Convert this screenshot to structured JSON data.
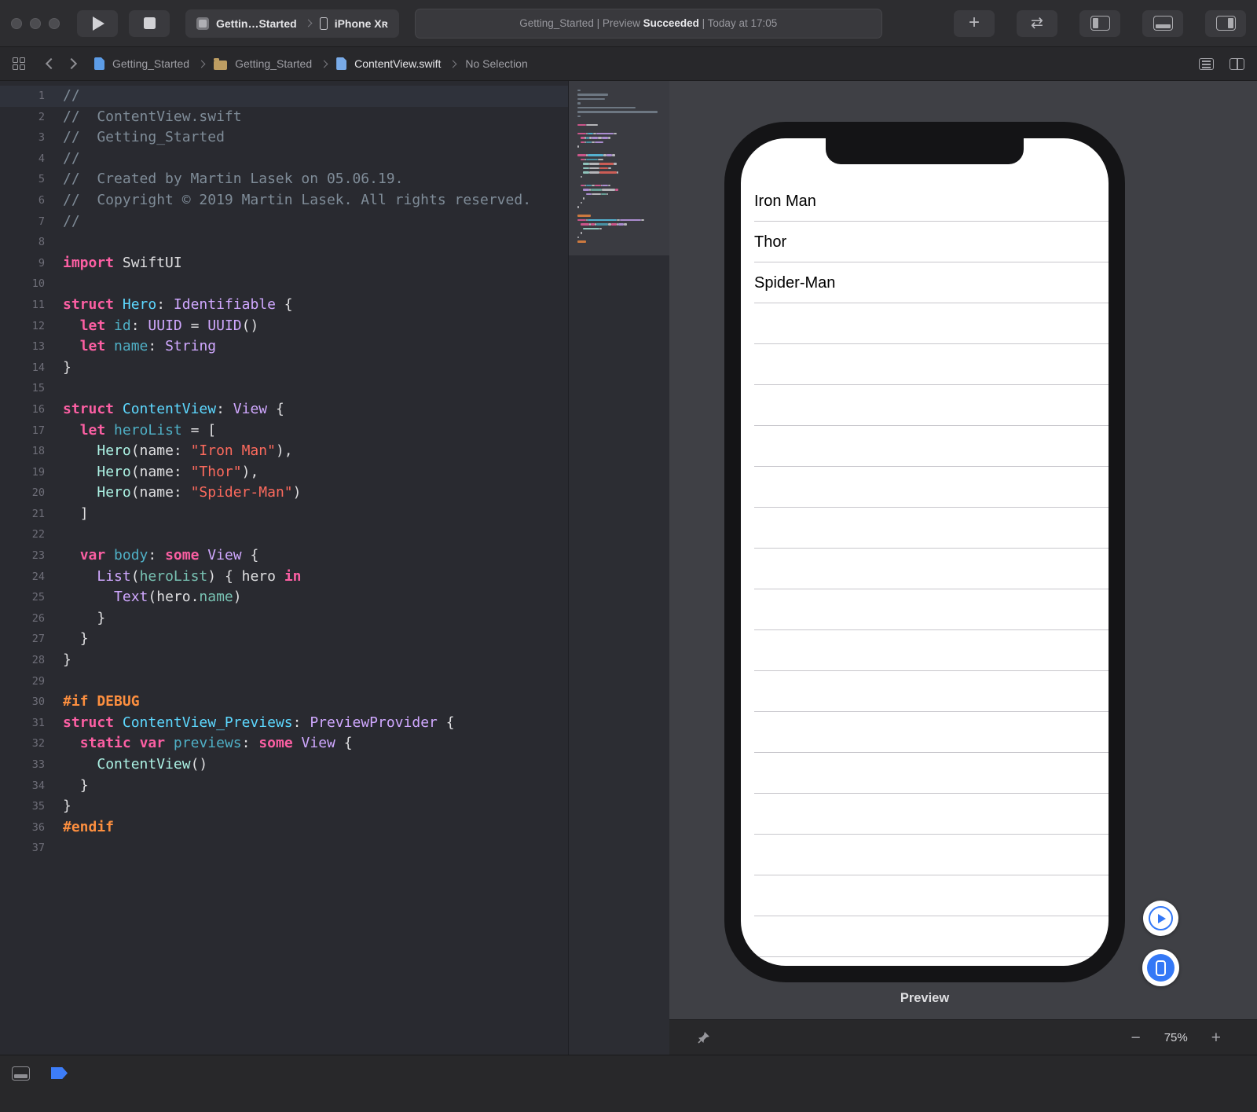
{
  "colors": {
    "accent": "#3478F6",
    "list_separator": "#C8C7CC"
  },
  "toolbar": {
    "scheme": "Gettin…Started",
    "device": "iPhone Xʀ",
    "status_prefix": "Getting_Started | Preview ",
    "status_bold": "Succeeded",
    "status_suffix": " | Today at 17:05",
    "library_plus": "+"
  },
  "jumpbar": {
    "project": "Getting_Started",
    "group": "Getting_Started",
    "file": "ContentView.swift",
    "selection": "No Selection"
  },
  "editor": {
    "token_colors": {
      "com": "#7F8C98",
      "kw": "#FC5FA3",
      "str": "#FC6A5D",
      "pre": "#FD8F3F",
      "tdecl": "#5DD8FF",
      "vdecl": "#4FB0C6",
      "ptype": "#ACF2E4",
      "stype": "#D0A8FF",
      "prop": "#78C2B3",
      "pl": "#DFDFE1",
      "ws": "transparent"
    },
    "lines": [
      [
        [
          "com",
          "//"
        ]
      ],
      [
        [
          "com",
          "//  ContentView.swift"
        ]
      ],
      [
        [
          "com",
          "//  Getting_Started"
        ]
      ],
      [
        [
          "com",
          "//"
        ]
      ],
      [
        [
          "com",
          "//  Created by Martin Lasek on 05.06.19."
        ]
      ],
      [
        [
          "com",
          "//  Copyright © 2019 Martin Lasek. All rights reserved."
        ]
      ],
      [
        [
          "com",
          "//"
        ]
      ],
      [],
      [
        [
          "kw",
          "import"
        ],
        [
          "pl",
          " SwiftUI"
        ]
      ],
      [],
      [
        [
          "kw",
          "struct"
        ],
        [
          "pl",
          " "
        ],
        [
          "tdecl",
          "Hero"
        ],
        [
          "pl",
          ": "
        ],
        [
          "stype",
          "Identifiable"
        ],
        [
          "pl",
          " {"
        ]
      ],
      [
        [
          "ws",
          "  "
        ],
        [
          "kw",
          "let"
        ],
        [
          "pl",
          " "
        ],
        [
          "vdecl",
          "id"
        ],
        [
          "pl",
          ": "
        ],
        [
          "stype",
          "UUID"
        ],
        [
          "pl",
          " = "
        ],
        [
          "stype",
          "UUID"
        ],
        [
          "pl",
          "()"
        ]
      ],
      [
        [
          "ws",
          "  "
        ],
        [
          "kw",
          "let"
        ],
        [
          "pl",
          " "
        ],
        [
          "vdecl",
          "name"
        ],
        [
          "pl",
          ": "
        ],
        [
          "stype",
          "String"
        ]
      ],
      [
        [
          "pl",
          "}"
        ]
      ],
      [],
      [
        [
          "kw",
          "struct"
        ],
        [
          "pl",
          " "
        ],
        [
          "tdecl",
          "ContentView"
        ],
        [
          "pl",
          ": "
        ],
        [
          "stype",
          "View"
        ],
        [
          "pl",
          " {"
        ]
      ],
      [
        [
          "ws",
          "  "
        ],
        [
          "kw",
          "let"
        ],
        [
          "pl",
          " "
        ],
        [
          "vdecl",
          "heroList"
        ],
        [
          "pl",
          " = ["
        ]
      ],
      [
        [
          "ws",
          "    "
        ],
        [
          "ptype",
          "Hero"
        ],
        [
          "pl",
          "(name: "
        ],
        [
          "str",
          "\"Iron Man\""
        ],
        [
          "pl",
          "),"
        ]
      ],
      [
        [
          "ws",
          "    "
        ],
        [
          "ptype",
          "Hero"
        ],
        [
          "pl",
          "(name: "
        ],
        [
          "str",
          "\"Thor\""
        ],
        [
          "pl",
          "),"
        ]
      ],
      [
        [
          "ws",
          "    "
        ],
        [
          "ptype",
          "Hero"
        ],
        [
          "pl",
          "(name: "
        ],
        [
          "str",
          "\"Spider-Man\""
        ],
        [
          "pl",
          ")"
        ]
      ],
      [
        [
          "ws",
          "  "
        ],
        [
          "pl",
          "]"
        ]
      ],
      [],
      [
        [
          "ws",
          "  "
        ],
        [
          "kw",
          "var"
        ],
        [
          "pl",
          " "
        ],
        [
          "vdecl",
          "body"
        ],
        [
          "pl",
          ": "
        ],
        [
          "kw",
          "some"
        ],
        [
          "pl",
          " "
        ],
        [
          "stype",
          "View"
        ],
        [
          "pl",
          " {"
        ]
      ],
      [
        [
          "ws",
          "    "
        ],
        [
          "stype",
          "List"
        ],
        [
          "pl",
          "("
        ],
        [
          "prop",
          "heroList"
        ],
        [
          "pl",
          ") { hero "
        ],
        [
          "kw",
          "in"
        ]
      ],
      [
        [
          "ws",
          "      "
        ],
        [
          "stype",
          "Text"
        ],
        [
          "pl",
          "(hero."
        ],
        [
          "prop",
          "name"
        ],
        [
          "pl",
          ")"
        ]
      ],
      [
        [
          "ws",
          "    "
        ],
        [
          "pl",
          "}"
        ]
      ],
      [
        [
          "ws",
          "  "
        ],
        [
          "pl",
          "}"
        ]
      ],
      [
        [
          "pl",
          "}"
        ]
      ],
      [],
      [
        [
          "pre",
          "#if DEBUG"
        ]
      ],
      [
        [
          "kw",
          "struct"
        ],
        [
          "pl",
          " "
        ],
        [
          "tdecl",
          "ContentView_Previews"
        ],
        [
          "pl",
          ": "
        ],
        [
          "stype",
          "PreviewProvider"
        ],
        [
          "pl",
          " {"
        ]
      ],
      [
        [
          "ws",
          "  "
        ],
        [
          "kw",
          "static"
        ],
        [
          "pl",
          " "
        ],
        [
          "kw",
          "var"
        ],
        [
          "pl",
          " "
        ],
        [
          "vdecl",
          "previews"
        ],
        [
          "pl",
          ": "
        ],
        [
          "kw",
          "some"
        ],
        [
          "pl",
          " "
        ],
        [
          "stype",
          "View"
        ],
        [
          "pl",
          " {"
        ]
      ],
      [
        [
          "ws",
          "    "
        ],
        [
          "ptype",
          "ContentView"
        ],
        [
          "pl",
          "()"
        ]
      ],
      [
        [
          "ws",
          "  "
        ],
        [
          "pl",
          "}"
        ]
      ],
      [
        [
          "pl",
          "}"
        ]
      ],
      [
        [
          "pre",
          "#endif"
        ]
      ],
      []
    ]
  },
  "canvas": {
    "heroes": [
      "Iron Man",
      "Thor",
      "Spider-Man"
    ],
    "empty_rows": 16,
    "preview_label": "Preview",
    "zoom_out": "−",
    "zoom_level": "75%",
    "zoom_in": "+"
  }
}
